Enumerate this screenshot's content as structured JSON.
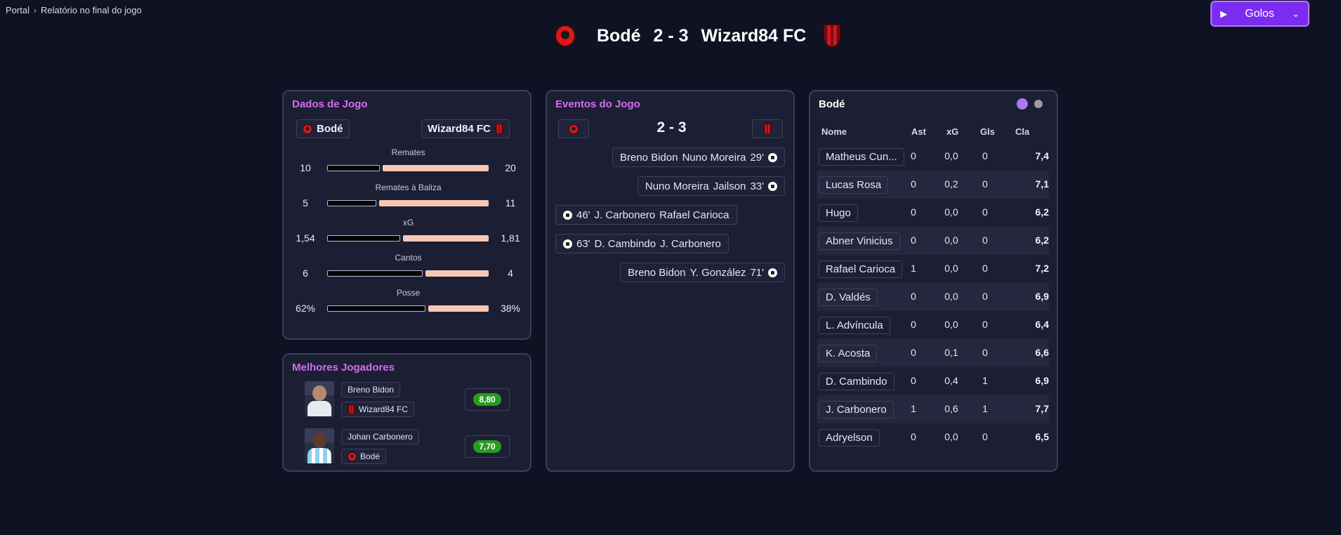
{
  "breadcrumb": {
    "root": "Portal",
    "current": "Relatório no final do jogo"
  },
  "play_button": {
    "label": "Golos",
    "play_icon": "play-icon",
    "chevron_icon": "chevron-down-icon"
  },
  "match": {
    "home": "Bodé",
    "away": "Wizard84 FC",
    "score": "2 - 3",
    "home_score": 2,
    "away_score": 3
  },
  "colors": {
    "accent": "#7b2cf0",
    "title": "#d46bf2",
    "bar_away": "#f8c7b4",
    "rating": "#2a9a24",
    "background": "#0f1223",
    "panel": "#1c1f34"
  },
  "dados": {
    "title": "Dados de Jogo",
    "home_team": "Bodé",
    "away_team": "Wizard84 FC",
    "stats": [
      {
        "label": "Remates",
        "home": "10",
        "away": "20",
        "home_share": 0.33
      },
      {
        "label": "Remates à Baliza",
        "home": "5",
        "away": "11",
        "home_share": 0.31
      },
      {
        "label": "xG",
        "home": "1,54",
        "away": "1,81",
        "home_share": 0.46
      },
      {
        "label": "Cantos",
        "home": "6",
        "away": "4",
        "home_share": 0.6
      },
      {
        "label": "Posse",
        "home": "62%",
        "away": "38%",
        "home_share": 0.62
      }
    ]
  },
  "best": {
    "title": "Melhores Jogadores",
    "players": [
      {
        "name": "Breno Bidon",
        "team": "Wizard84 FC",
        "rating": "8,80"
      },
      {
        "name": "Johan Carbonero",
        "team": "Bodé",
        "rating": "7,70"
      }
    ]
  },
  "eventos": {
    "title": "Eventos do Jogo",
    "score": "2 - 3",
    "events": [
      {
        "side": "away",
        "player": "Breno Bidon",
        "assist": "Nuno Moreira",
        "minute": "29'"
      },
      {
        "side": "away",
        "player": "Nuno Moreira",
        "assist": "Jailson",
        "minute": "33'"
      },
      {
        "side": "home",
        "minute": "46'",
        "player": "J. Carbonero",
        "assist": "Rafael Carioca"
      },
      {
        "side": "home",
        "minute": "63'",
        "player": "D. Cambindo",
        "assist": "J. Carbonero"
      },
      {
        "side": "away",
        "player": "Breno Bidon",
        "assist": "Y. González",
        "minute": "71'"
      }
    ]
  },
  "table": {
    "title": "Bodé",
    "headers": {
      "name": "Nome",
      "ast": "Ast",
      "xg": "xG",
      "gls": "Gls",
      "cla": "Cla"
    },
    "rows": [
      {
        "name": "Matheus Cun...",
        "ast": "0",
        "xg": "0,0",
        "gls": "0",
        "cla": "7,4"
      },
      {
        "name": "Lucas Rosa",
        "ast": "0",
        "xg": "0,2",
        "gls": "0",
        "cla": "7,1"
      },
      {
        "name": "Hugo",
        "ast": "0",
        "xg": "0,0",
        "gls": "0",
        "cla": "6,2"
      },
      {
        "name": "Abner Vinicius",
        "ast": "0",
        "xg": "0,0",
        "gls": "0",
        "cla": "6,2"
      },
      {
        "name": "Rafael Carioca",
        "ast": "1",
        "xg": "0,0",
        "gls": "0",
        "cla": "7,2"
      },
      {
        "name": "D. Valdés",
        "ast": "0",
        "xg": "0,0",
        "gls": "0",
        "cla": "6,9"
      },
      {
        "name": "L. Advíncula",
        "ast": "0",
        "xg": "0,0",
        "gls": "0",
        "cla": "6,4"
      },
      {
        "name": "K. Acosta",
        "ast": "0",
        "xg": "0,1",
        "gls": "0",
        "cla": "6,6"
      },
      {
        "name": "D. Cambindo",
        "ast": "0",
        "xg": "0,4",
        "gls": "1",
        "cla": "6,9"
      },
      {
        "name": "J. Carbonero",
        "ast": "1",
        "xg": "0,6",
        "gls": "1",
        "cla": "7,7"
      },
      {
        "name": "Adryelson",
        "ast": "0",
        "xg": "0,0",
        "gls": "0",
        "cla": "6,5"
      }
    ]
  }
}
